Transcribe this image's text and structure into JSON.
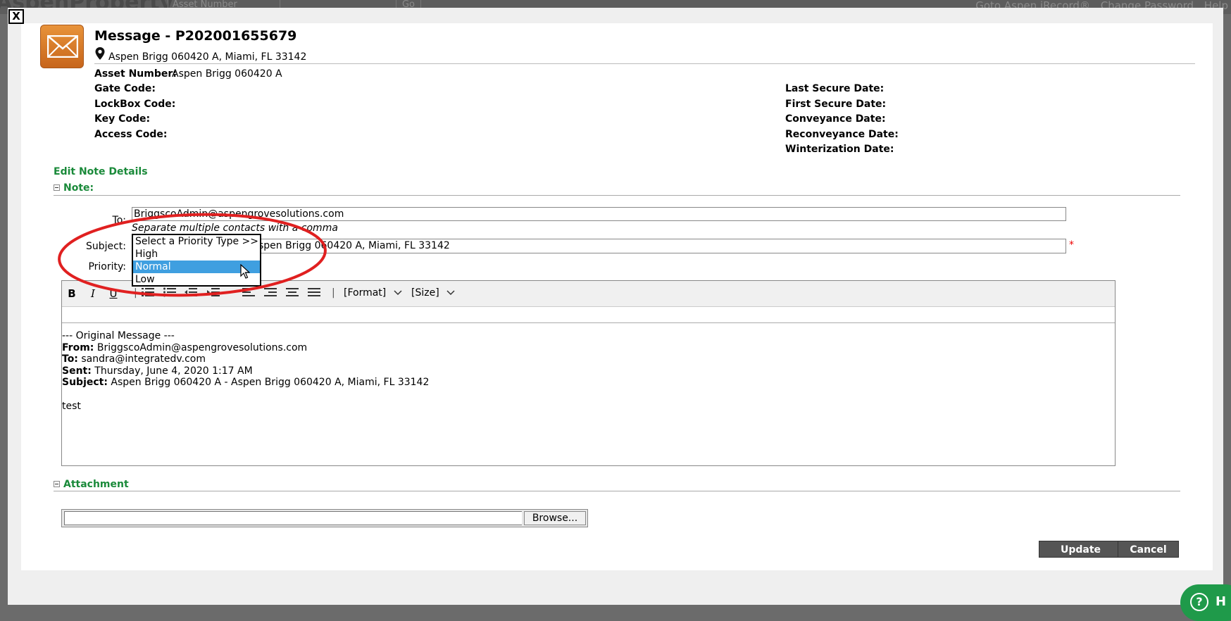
{
  "background": {
    "logo": "AspenProperty",
    "select_text": "Asset Number",
    "go": "Go",
    "links": [
      "Goto Aspen iRecord®",
      "Change Password",
      "Help"
    ]
  },
  "dialog": {
    "close_label": "X",
    "title": "Message - P202001655679",
    "address": "Aspen Brigg 060420 A, Miami, FL 33142",
    "asset_label": "Asset Number:",
    "asset_value": "Aspen Brigg 060420 A",
    "left_fields": [
      "Gate Code:",
      "LockBox Code:",
      "Key Code:",
      "Access Code:"
    ],
    "right_fields": [
      "Last Secure Date:",
      "First Secure Date:",
      "Conveyance Date:",
      "Reconveyance Date:",
      "Winterization Date:"
    ]
  },
  "note": {
    "section_title": "Edit Note Details",
    "subsection": "Note:",
    "to_label": "To:",
    "to_value": "BriggscoAdmin@aspengrovesolutions.com",
    "hint": "Separate multiple contacts with a comma",
    "subject_label": "Subject:",
    "subject_value": "Aspen Brigg 060420 A - Aspen Brigg 060420 A, Miami, FL 33142",
    "subject_visible": "spen Brigg 060420 A, Miami, FL 33142",
    "required_mark": "*",
    "priority_label": "Priority:",
    "priority_options": [
      "Select a Priority Type >>",
      "High",
      "Normal",
      "Low"
    ],
    "priority_selected": "Normal"
  },
  "editor": {
    "toolbar": {
      "bold": "B",
      "italic": "I",
      "underline": "U",
      "sep": "|",
      "format": "[Format]",
      "size": "[Size]"
    },
    "body": {
      "line1": "--- Original Message ---",
      "from_label": "From:",
      "from_value": "BriggscoAdmin@aspengrovesolutions.com",
      "to_label": "To:",
      "to_value": "sandra@integratedv.com",
      "sent_label": "Sent:",
      "sent_value": "Thursday, June 4, 2020 1:17 AM",
      "subject_label": "Subject:",
      "subject_value": "Aspen Brigg 060420 A - Aspen Brigg 060420 A, Miami, FL 33142",
      "message": "test"
    }
  },
  "attachment": {
    "title": "Attachment",
    "browse": "Browse..."
  },
  "buttons": {
    "update": "Update",
    "cancel": "Cancel"
  },
  "help": {
    "icon": "?",
    "label": "H"
  },
  "colors": {
    "accent_green": "#1a8a3a",
    "selection_blue": "#3f9fe0",
    "annotation_red": "#e02020",
    "button_gray": "#555555"
  }
}
